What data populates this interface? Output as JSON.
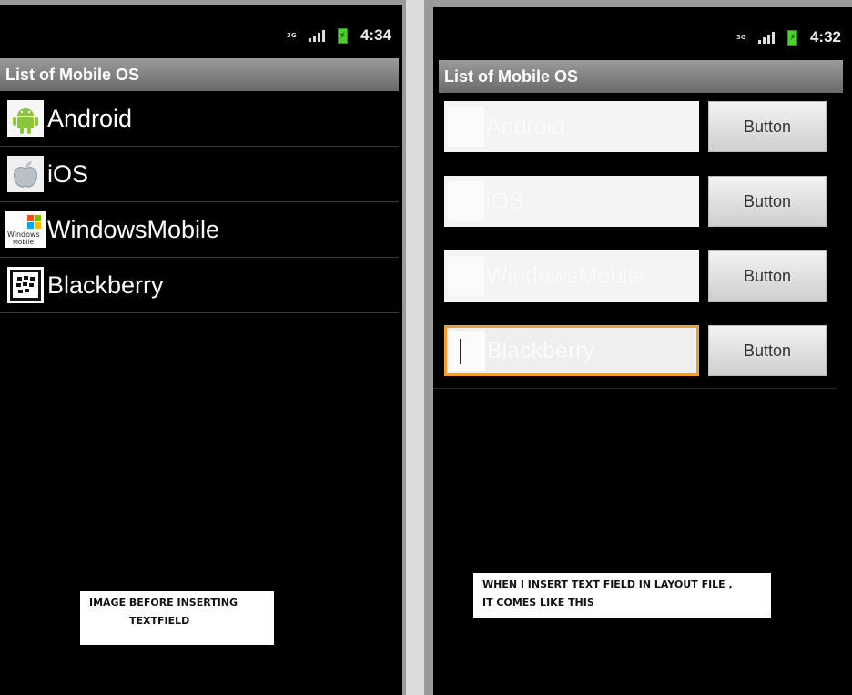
{
  "left_screen": {
    "status": {
      "network": "3G",
      "time": "4:34"
    },
    "title": "List of Mobile OS",
    "items": [
      {
        "label": "Android",
        "icon": "android-icon"
      },
      {
        "label": "iOS",
        "icon": "apple-icon"
      },
      {
        "label": "WindowsMobile",
        "icon": "windows-mobile-icon"
      },
      {
        "label": "Blackberry",
        "icon": "blackberry-icon"
      }
    ],
    "caption": {
      "line1": "IMAGE BEFORE INSERTING",
      "line2": "TEXTFIELD"
    }
  },
  "right_screen": {
    "status": {
      "network": "3G",
      "time": "4:32"
    },
    "title": "List of Mobile OS",
    "rows": [
      {
        "field_text": "Android",
        "button": "Button"
      },
      {
        "field_text": "iOS",
        "button": "Button"
      },
      {
        "field_text": "WindowsMobile",
        "button": "Button"
      },
      {
        "field_text": "Blackberry",
        "button": "Button",
        "focused": true
      }
    ],
    "caption": {
      "line1": "WHEN I INSERT TEXT FIELD IN LAYOUT FILE ,",
      "line2": "IT COMES LIKE THIS"
    }
  },
  "colors": {
    "focus": "#f0a030",
    "battery": "#4cd12c",
    "titlebar": "#8a8a8a"
  }
}
